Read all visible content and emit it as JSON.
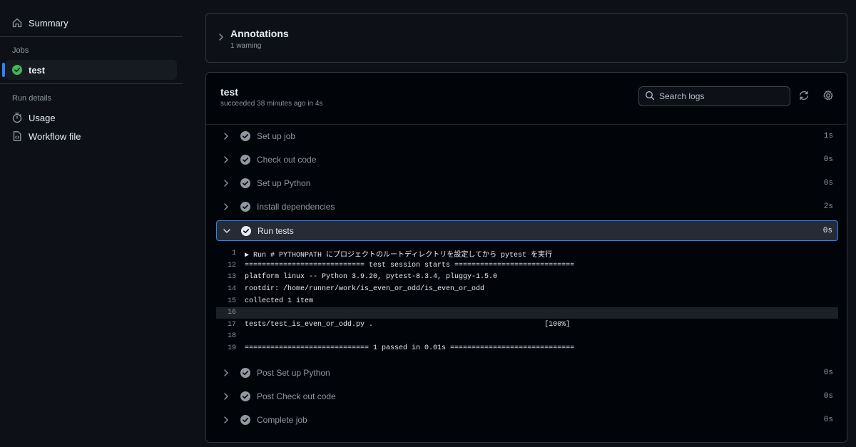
{
  "sidebar": {
    "summary": "Summary",
    "jobs_label": "Jobs",
    "job": "test",
    "run_details_label": "Run details",
    "usage": "Usage",
    "workflow_file": "Workflow file"
  },
  "annotations": {
    "title": "Annotations",
    "subtitle": "1 warning"
  },
  "job": {
    "title": "test",
    "subtitle": "succeeded 38 minutes ago in 4s",
    "search_placeholder": "Search logs",
    "steps": [
      {
        "name": "Set up job",
        "duration": "1s"
      },
      {
        "name": "Check out code",
        "duration": "0s"
      },
      {
        "name": "Set up Python",
        "duration": "0s"
      },
      {
        "name": "Install dependencies",
        "duration": "2s"
      },
      {
        "name": "Run tests",
        "duration": "0s"
      },
      {
        "name": "Post Set up Python",
        "duration": "0s"
      },
      {
        "name": "Post Check out code",
        "duration": "0s"
      },
      {
        "name": "Complete job",
        "duration": "0s"
      }
    ],
    "logs": [
      {
        "line": "1",
        "text": "▶ Run # PYTHONPATH にプロジェクトのルートディレクトリを設定してから pytest を実行"
      },
      {
        "line": "12",
        "text": "============================ test session starts ============================"
      },
      {
        "line": "13",
        "text": "platform linux -- Python 3.9.20, pytest-8.3.4, pluggy-1.5.0"
      },
      {
        "line": "14",
        "text": "rootdir: /home/runner/work/is_even_or_odd/is_even_or_odd"
      },
      {
        "line": "15",
        "text": "collected 1 item"
      },
      {
        "line": "16",
        "text": ""
      },
      {
        "line": "17",
        "text": "tests/test_is_even_or_odd.py .                                        [100%]"
      },
      {
        "line": "18",
        "text": ""
      },
      {
        "line": "19",
        "text": "============================= 1 passed in 0.01s ============================="
      }
    ]
  },
  "colors": {
    "accent": "#2f81f7",
    "success": "#3fb950",
    "muted": "#8d96a0"
  }
}
